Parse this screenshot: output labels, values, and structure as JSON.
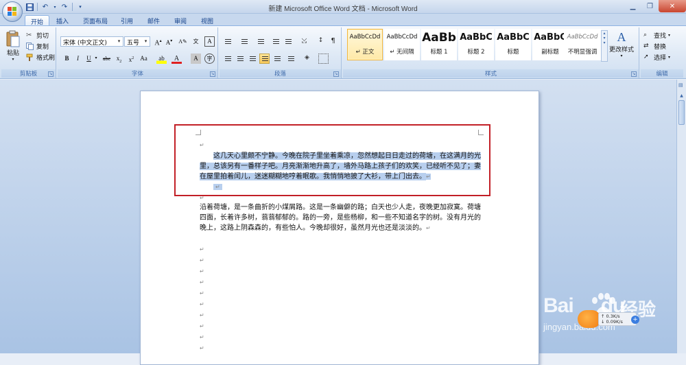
{
  "window": {
    "title": "新建 Microsoft Office Word 文档 - Microsoft Word"
  },
  "tabs": [
    "开始",
    "插入",
    "页面布局",
    "引用",
    "邮件",
    "审阅",
    "视图"
  ],
  "clipboard": {
    "paste": "粘贴",
    "cut": "剪切",
    "copy": "复制",
    "format_painter": "格式刷",
    "label": "剪贴板"
  },
  "font": {
    "name": "宋体 (中文正文)",
    "size": "五号",
    "label": "字体"
  },
  "paragraph": {
    "label": "段落"
  },
  "styles": {
    "label": "样式",
    "items": [
      {
        "sample": "AaBbCcDd",
        "name": "↵ 正文"
      },
      {
        "sample": "AaBbCcDd",
        "name": "↵ 无间隔"
      },
      {
        "sample": "AaBb",
        "name": "标题 1"
      },
      {
        "sample": "AaBbC",
        "name": "标题 2"
      },
      {
        "sample": "AaBbC",
        "name": "标题"
      },
      {
        "sample": "AaBbC",
        "name": "副标题"
      },
      {
        "sample": "AaBbCcDd",
        "name": "不明显强调"
      }
    ],
    "change_styles": "更改样式"
  },
  "editing": {
    "find": "查找",
    "replace": "替换",
    "select": "选择",
    "label": "编辑"
  },
  "document": {
    "para1": "这几天心里颇不宁静。今晚在院子里坐着乘凉，忽然想起日日走过的荷塘，在这满月的光里，总该另有一番样子吧。月亮渐渐地升高了，墙外马路上孩子们的欢笑，已经听不见了；妻在屋里拍着闰儿，迷迷糊糊地哼着眠歌。我悄悄地披了大衫，带上门出去。",
    "para2": "沿着荷塘，是一条曲折的小煤屑路。这是一条幽僻的路；白天也少人走，夜晚更加寂寞。荷塘四面，长着许多树，蓊蓊郁郁的。路的一旁，是些杨柳，和一些不知道名字的树。没有月光的晚上，这路上阴森森的，有些怕人。今晚却很好，虽然月光也还是淡淡的。",
    "para_mark": "↵"
  },
  "watermark": {
    "brand": "Bai",
    "brand2": "du",
    "jingyan": "经验",
    "url": "jingyan.baidu.com"
  },
  "speed_badge": {
    "up": "0.3K/s",
    "down": "0.09K/s"
  }
}
